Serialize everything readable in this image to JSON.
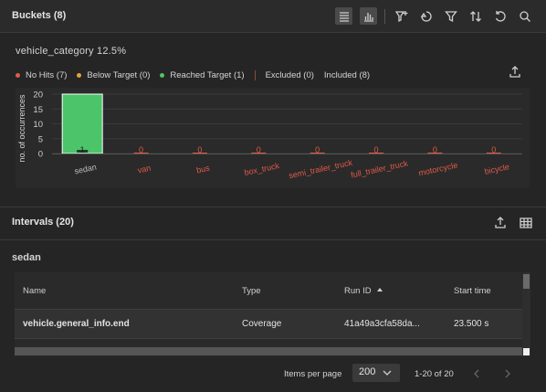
{
  "header": {
    "title": "Buckets (8)",
    "tools": [
      "list-view-icon",
      "bar-chart-view-icon",
      "add-filter-icon",
      "swap-icon",
      "filter-icon",
      "sort-icon",
      "reset-icon",
      "search-icon"
    ]
  },
  "buckets": {
    "category_label": "vehicle_category 12.5%",
    "legend": [
      {
        "label": "No Hits (7)",
        "color": "#e05a4a"
      },
      {
        "label": "Below Target (0)",
        "color": "#e0a63a"
      },
      {
        "label": "Reached Target (1)",
        "color": "#4cc46a"
      }
    ],
    "legend_extra": [
      {
        "label": "Excluded (0)"
      },
      {
        "label": "Included (8)"
      }
    ]
  },
  "chart_data": {
    "type": "bar",
    "ylabel": "no. of occurrences",
    "ylim": [
      0,
      20
    ],
    "yticks": [
      "20",
      "15",
      "10",
      "5",
      "0"
    ],
    "categories": [
      "sedan",
      "van",
      "bus",
      "box_truck",
      "semi_trailer_truck",
      "full_trailer_truck",
      "motorcycle",
      "bicycle"
    ],
    "values": [
      20,
      0,
      0,
      0,
      0,
      0,
      0,
      0
    ],
    "bar_labels": [
      "1",
      "0",
      "0",
      "0",
      "0",
      "0",
      "0",
      "0"
    ],
    "colors": {
      "reached": "#4cc46a",
      "no_hits": "#e05a4a",
      "reached_label": "#d0d0d0"
    }
  },
  "intervals": {
    "title": "Intervals (20)",
    "subtitle": "sedan",
    "columns": [
      "Name",
      "Type",
      "Run ID",
      "Start time"
    ],
    "rows": [
      {
        "name": "vehicle.general_info.end",
        "type": "Coverage",
        "run_id": "41a49a3cfa58da...",
        "start": "23.500 s"
      }
    ]
  },
  "pagination": {
    "items_label": "Items per page",
    "per_page": "200",
    "range": "1-20 of 20"
  }
}
